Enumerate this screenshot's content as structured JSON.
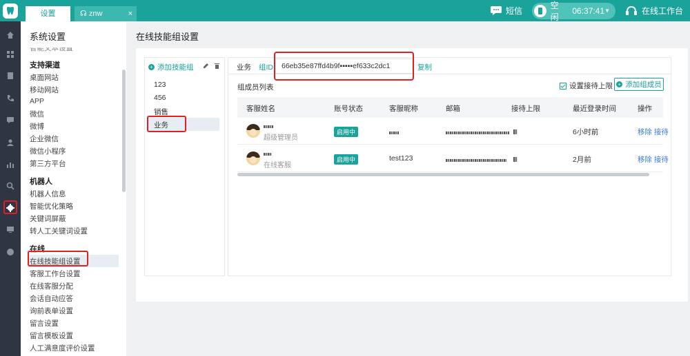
{
  "topbar": {
    "tabs": [
      {
        "label": "设置",
        "active": true
      },
      {
        "label": "znw",
        "active": false,
        "close": "×"
      }
    ],
    "sms_label": "短信",
    "status_label": "空闲",
    "timer": "06:37:41",
    "workbench_label": "在线工作台"
  },
  "rail": {
    "icons": [
      "home-icon",
      "grid-icon",
      "document-icon",
      "phone-icon",
      "chat-icon",
      "contacts-icon",
      "chart-icon",
      "search-icon",
      "settings-icon",
      "monitor-icon",
      "user-icon"
    ],
    "active": "settings-icon"
  },
  "sidebar": {
    "title": "系统设置",
    "partial_item": "智能文本设置",
    "groups": [
      {
        "title": "支持渠道",
        "items": [
          "桌面网站",
          "移动网站",
          "APP",
          "微信",
          "微博",
          "企业微信",
          "微信小程序",
          "第三方平台"
        ]
      },
      {
        "title": "机器人",
        "items": [
          "机器人信息",
          "智能优化策略",
          "关键词屏蔽",
          "转人工关键词设置"
        ]
      },
      {
        "title": "在线",
        "items": [
          "在线技能组设置",
          "客服工作台设置",
          "在线客服分配",
          "会话自动应答",
          "询前表单设置",
          "留言设置",
          "留言模板设置",
          "人工满意度评价设置"
        ]
      }
    ],
    "active_item": "在线技能组设置"
  },
  "main": {
    "title": "在线技能组设置",
    "add_group_label": "添加技能组",
    "groups": [
      "123",
      "456",
      "销售",
      "业务"
    ],
    "active_group": "业务",
    "detail": {
      "group_name": "业务",
      "id_label": "组ID",
      "id_value": "66eb35e87ffd4b9f▪▪▪▪▪ef633c2dc1",
      "copy_label": "复制",
      "member_list_title": "组成员列表",
      "set_limit_label": "设置接待上限",
      "add_member_label": "添加组成员",
      "columns": [
        "客服姓名",
        "账号状态",
        "客服昵称",
        "邮箱",
        "接待上限",
        "最近登录时间",
        "操作"
      ],
      "rows": [
        {
          "role": "超级管理员",
          "status": "启用中",
          "nickname": "",
          "last_login": "6小时前",
          "ops": "移除  接待"
        },
        {
          "role": "在线客服",
          "status": "启用中",
          "nickname": "test123",
          "last_login": "2月前",
          "ops": "移除  接待"
        }
      ]
    }
  },
  "colors": {
    "brand": "#1aa39b",
    "highlight": "#e02020",
    "rail": "#2f3543",
    "link": "#3a7bd5"
  }
}
